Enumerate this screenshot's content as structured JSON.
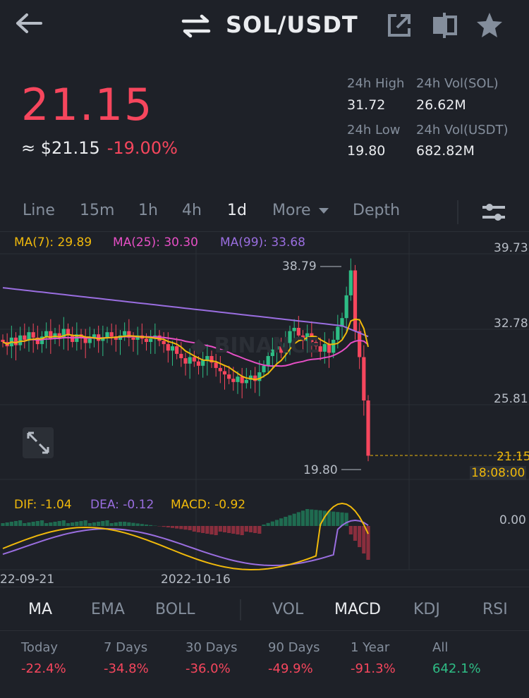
{
  "header": {
    "pair": "SOL/USDT"
  },
  "price": {
    "last": "21.15",
    "approx": "≈ $21.15",
    "change": "-19.00%"
  },
  "stats": {
    "high_label": "24h High",
    "high_value": "31.72",
    "vol_base_label": "24h Vol(SOL)",
    "vol_base_value": "26.62M",
    "low_label": "24h Low",
    "low_value": "19.80",
    "vol_quote_label": "24h Vol(USDT)",
    "vol_quote_value": "682.82M"
  },
  "intervals": {
    "line": "Line",
    "m15": "15m",
    "h1": "1h",
    "h4": "4h",
    "d1": "1d",
    "more": "More",
    "depth": "Depth"
  },
  "ma_legend": {
    "ma7": "MA(7): 29.89",
    "ma25": "MA(25): 30.30",
    "ma99": "MA(99): 33.68"
  },
  "price_axis": {
    "t1": "39.73",
    "t2": "32.78",
    "t3": "25.81",
    "last": "21.15",
    "countdown": "18:08:00"
  },
  "annotations": {
    "high": "38.79",
    "low": "19.80"
  },
  "macd_legend": {
    "dif": "DIF: -1.04",
    "dea": "DEA: -0.12",
    "macd": "MACD: -0.92"
  },
  "macd_axis": {
    "zero": "0.00"
  },
  "dates": {
    "d1": "22-09-21",
    "d2": "2022-10-16"
  },
  "indicators": {
    "ma": "MA",
    "ema": "EMA",
    "boll": "BOLL",
    "vol": "VOL",
    "macd": "MACD",
    "kdj": "KDJ",
    "rsi": "RSI"
  },
  "performance": [
    {
      "label": "Today",
      "value": "-22.4%"
    },
    {
      "label": "7 Days",
      "value": "-34.8%"
    },
    {
      "label": "30 Days",
      "value": "-36.0%"
    },
    {
      "label": "90 Days",
      "value": "-49.9%"
    },
    {
      "label": "1 Year",
      "value": "-91.3%"
    },
    {
      "label": "All",
      "value": "642.1%"
    }
  ],
  "colors": {
    "up": "#2ebd85",
    "down": "#f6465d",
    "ma7": "#f0b90b",
    "ma25": "#e64fc5",
    "ma99": "#9a6ee0"
  }
}
